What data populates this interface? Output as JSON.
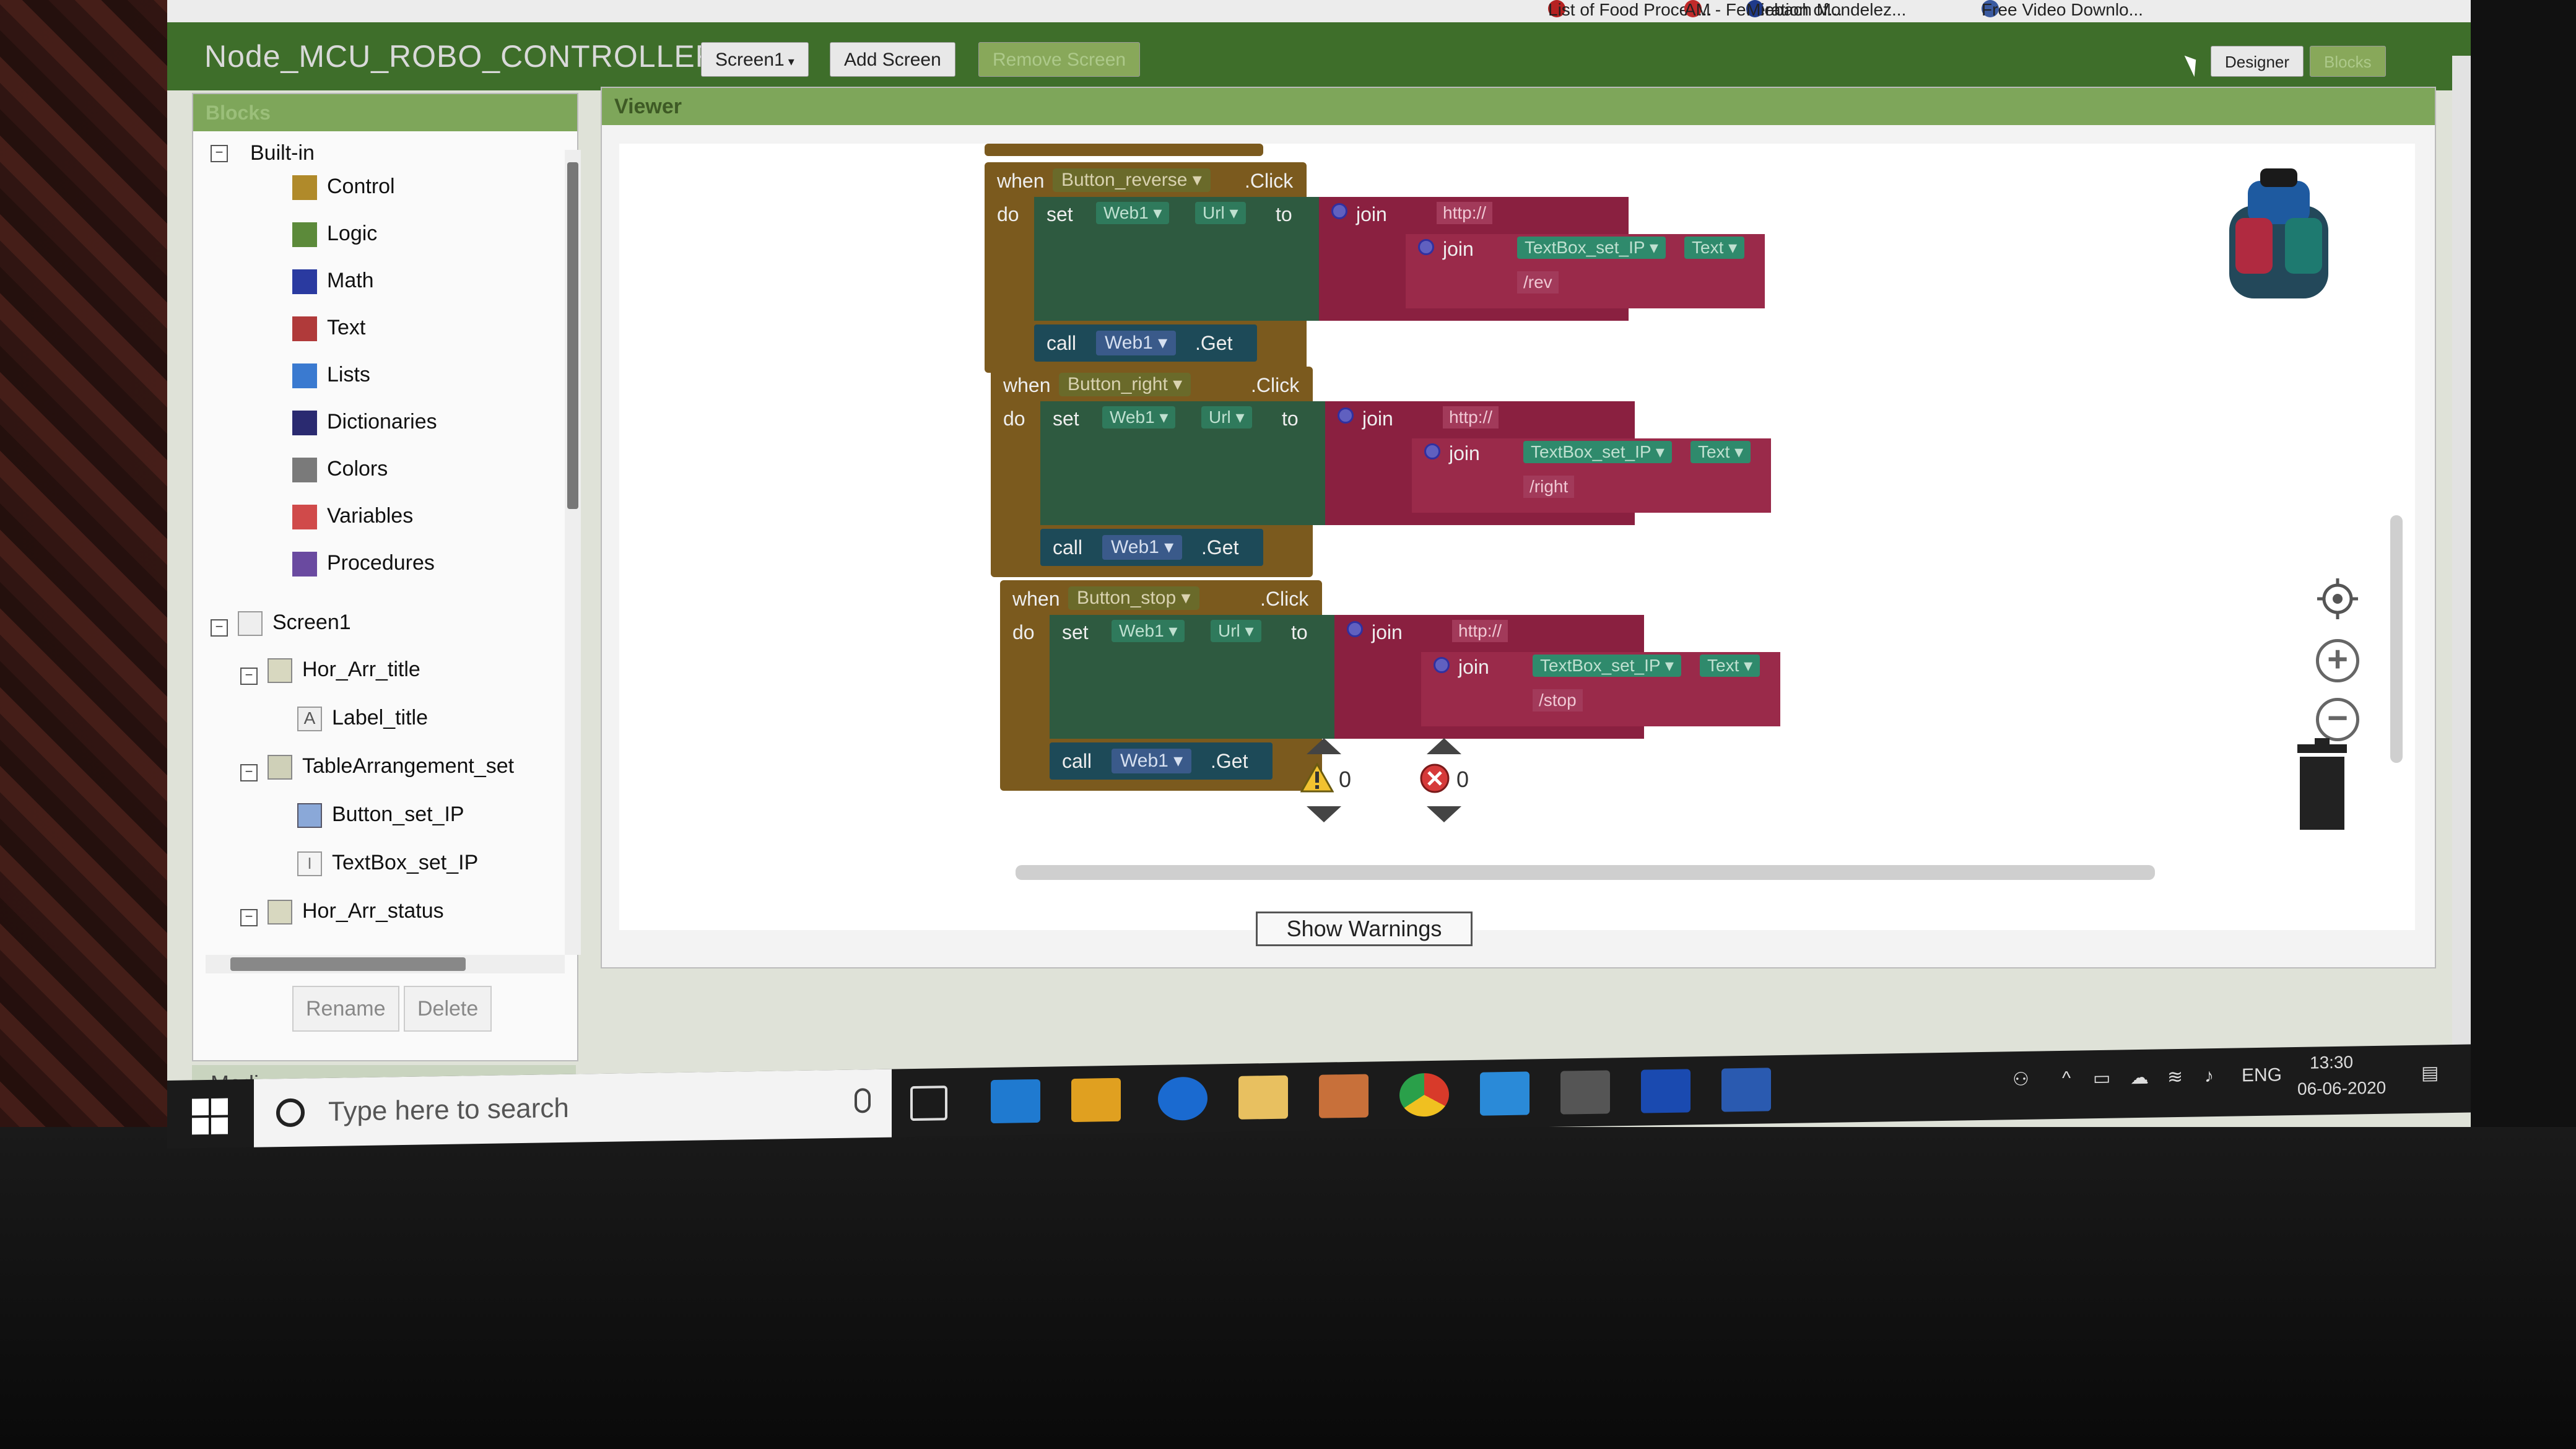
{
  "bookmarks": [
    "Free Video Downlo...",
    "Miebach Mondelez...",
    "AM - Federation of...",
    "List of Food Proces..."
  ],
  "topbar": {
    "project_title": "Node_MCU_ROBO_CONTROLLER",
    "screen_select": "Screen1",
    "add_screen": "Add Screen",
    "remove_screen": "Remove Screen",
    "designer": "Designer",
    "blocks": "Blocks"
  },
  "blocks_panel": {
    "header": "Blocks",
    "builtin_label": "Built-in",
    "builtin": [
      {
        "label": "Control",
        "color": "#b08a2a"
      },
      {
        "label": "Logic",
        "color": "#5c8a3a"
      },
      {
        "label": "Math",
        "color": "#2a3aa0"
      },
      {
        "label": "Text",
        "color": "#b03a3a"
      },
      {
        "label": "Lists",
        "color": "#3a7ad0"
      },
      {
        "label": "Dictionaries",
        "color": "#2a2a70"
      },
      {
        "label": "Colors",
        "color": "#7a7a7a"
      },
      {
        "label": "Variables",
        "color": "#d04a4a"
      },
      {
        "label": "Procedures",
        "color": "#6a4aa0"
      }
    ],
    "components": {
      "screen": "Screen1",
      "hor_arr_title": "Hor_Arr_title",
      "label_title": "Label_title",
      "table_arr": "TableArrangement_set",
      "button_set_ip": "Button_set_IP",
      "textbox_set_ip": "TextBox_set_IP",
      "hor_arr_status": "Hor_Arr_status"
    },
    "rename": "Rename",
    "delete": "Delete",
    "media": "Media"
  },
  "viewer": {
    "header": "Viewer",
    "blocks": [
      {
        "button": "Button_reverse",
        "path": "/rev"
      },
      {
        "button": "Button_right",
        "path": "/right"
      },
      {
        "button": "Button_stop",
        "path": "/stop"
      }
    ],
    "common": {
      "when": "when",
      "click": ".Click",
      "do": "do",
      "set": "set",
      "to": "to",
      "web": "Web1",
      "url": "Url",
      "join": "join",
      "http": "http://",
      "textbox": "TextBox_set_IP",
      "text": "Text",
      "call": "call",
      "get": ".Get"
    },
    "warnings_count": "0",
    "errors_count": "0",
    "show_warnings": "Show Warnings"
  },
  "taskbar": {
    "search_placeholder": "Type here to search",
    "lang": "ENG",
    "time": "13:30",
    "date": "06-06-2020"
  }
}
